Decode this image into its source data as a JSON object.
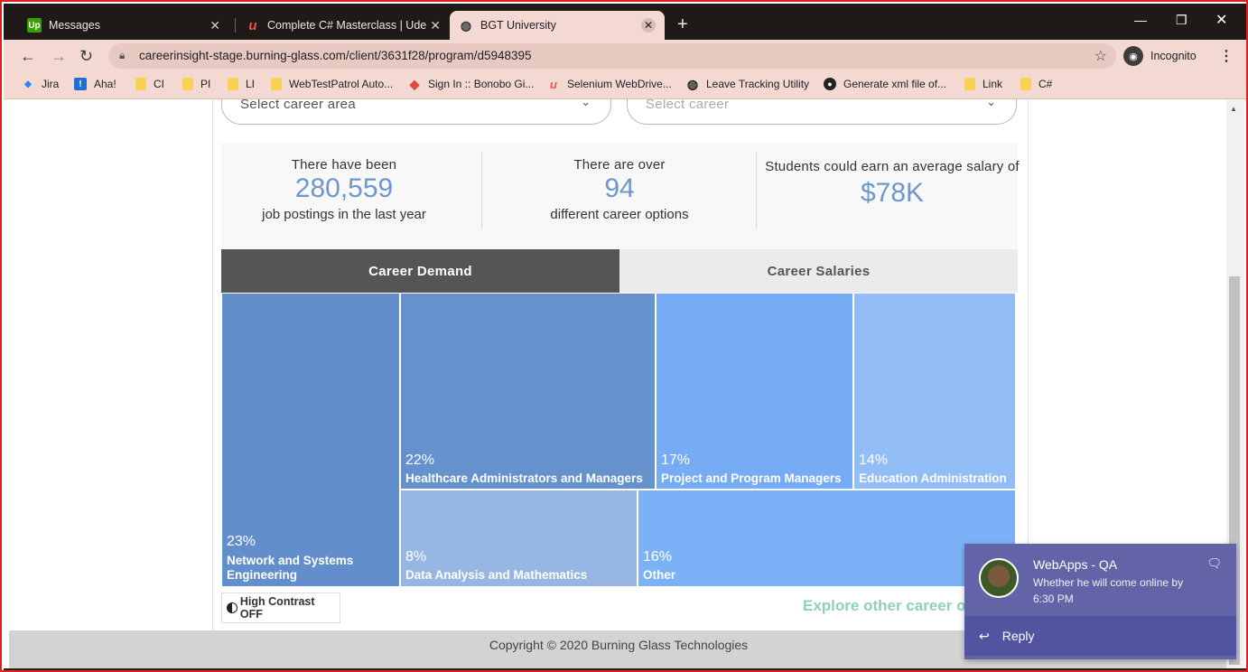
{
  "browser": {
    "tabs": [
      {
        "title": "Messages",
        "icon": "upwork-icon",
        "icon_text": "Up"
      },
      {
        "title": "Complete C# Masterclass | Udem",
        "icon": "udemy-icon",
        "icon_text": "u"
      },
      {
        "title": "BGT University",
        "icon": "globe-icon",
        "icon_text": "◍"
      }
    ],
    "new_tab": "+",
    "url": "careerinsight-stage.burning-glass.com/client/3631f28/program/d5948395",
    "incognito_label": "Incognito",
    "bookmarks": [
      {
        "label": "Jira",
        "icon": "jira-icon"
      },
      {
        "label": "Aha!",
        "icon": "aha-icon"
      },
      {
        "label": "CI",
        "icon": "folder-icon"
      },
      {
        "label": "PI",
        "icon": "folder-icon"
      },
      {
        "label": "LI",
        "icon": "folder-icon"
      },
      {
        "label": "WebTestPatrol Auto...",
        "icon": "folder-icon"
      },
      {
        "label": "Sign In :: Bonobo Gi...",
        "icon": "bonobo-icon"
      },
      {
        "label": "Selenium WebDrive...",
        "icon": "udemy-icon"
      },
      {
        "label": "Leave Tracking Utility",
        "icon": "globe-icon"
      },
      {
        "label": "Generate xml file of...",
        "icon": "github-icon"
      },
      {
        "label": "Link",
        "icon": "folder-icon"
      },
      {
        "label": "C#",
        "icon": "folder-icon"
      }
    ]
  },
  "filters": {
    "career_area_placeholder": "Select career area",
    "career_placeholder": "Select career"
  },
  "stats": [
    {
      "lead": "There have been",
      "value": "280,559",
      "tail": "job postings in the last year"
    },
    {
      "lead": "There are over",
      "value": "94",
      "tail": "different career options"
    },
    {
      "lead": "Students could earn an average salary of",
      "value": "$78K",
      "tail": ""
    }
  ],
  "career_tabs": {
    "demand": "Career Demand",
    "salaries": "Career Salaries"
  },
  "treemap": [
    {
      "pct": "23%",
      "label": "Network and Systems Engineering",
      "color": "#628fcb"
    },
    {
      "pct": "22%",
      "label": "Healthcare Administrators and Managers",
      "color": "#6591cc"
    },
    {
      "pct": "17%",
      "label": "Project and Program Managers",
      "color": "#76acf5"
    },
    {
      "pct": "14%",
      "label": "Education Administration",
      "color": "#93bdf7"
    },
    {
      "pct": "8%",
      "label": "Data Analysis and Mathematics",
      "color": "#97b6e3"
    },
    {
      "pct": "16%",
      "label": "Other",
      "color": "#7bb2f7"
    }
  ],
  "high_contrast": "High Contrast OFF",
  "explore": "Explore other career op",
  "footer": "Copyright © 2020 Burning Glass Technologies",
  "notification": {
    "title": "WebApps - QA",
    "message": "Whether he will come online by 6:30 PM",
    "reply": "Reply"
  },
  "colors": {
    "accent": "#6e97cc",
    "explore": "#8ed1b8",
    "teams": "#6264a7"
  }
}
